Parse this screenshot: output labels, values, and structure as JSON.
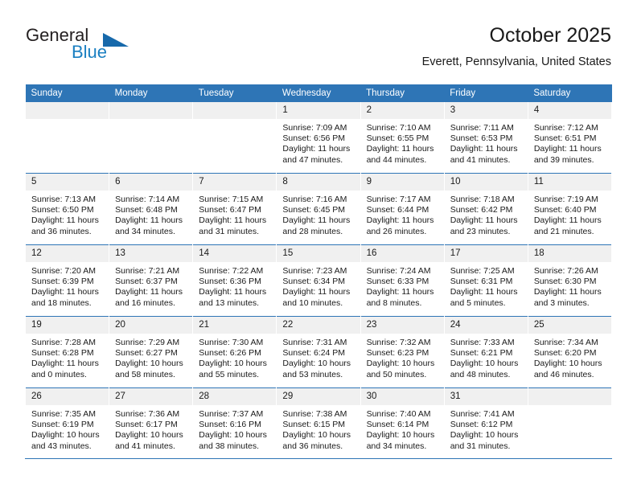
{
  "brand": {
    "name_part1": "General",
    "name_part2": "Blue",
    "logo_icon": "triangle-icon"
  },
  "header": {
    "title": "October 2025",
    "location": "Everett, Pennsylvania, United States"
  },
  "colors": {
    "header_bar": "#2e75b6",
    "day_band": "#f0f0f0",
    "brand_blue": "#1a7fc1",
    "text": "#1a1a1a"
  },
  "weekday_headers": [
    "Sunday",
    "Monday",
    "Tuesday",
    "Wednesday",
    "Thursday",
    "Friday",
    "Saturday"
  ],
  "weeks": [
    [
      {
        "day": "",
        "empty": true,
        "sunrise": "",
        "sunset": "",
        "daylight1": "",
        "daylight2": ""
      },
      {
        "day": "",
        "empty": true,
        "sunrise": "",
        "sunset": "",
        "daylight1": "",
        "daylight2": ""
      },
      {
        "day": "",
        "empty": true,
        "sunrise": "",
        "sunset": "",
        "daylight1": "",
        "daylight2": ""
      },
      {
        "day": "1",
        "sunrise": "Sunrise: 7:09 AM",
        "sunset": "Sunset: 6:56 PM",
        "daylight1": "Daylight: 11 hours",
        "daylight2": "and 47 minutes."
      },
      {
        "day": "2",
        "sunrise": "Sunrise: 7:10 AM",
        "sunset": "Sunset: 6:55 PM",
        "daylight1": "Daylight: 11 hours",
        "daylight2": "and 44 minutes."
      },
      {
        "day": "3",
        "sunrise": "Sunrise: 7:11 AM",
        "sunset": "Sunset: 6:53 PM",
        "daylight1": "Daylight: 11 hours",
        "daylight2": "and 41 minutes."
      },
      {
        "day": "4",
        "sunrise": "Sunrise: 7:12 AM",
        "sunset": "Sunset: 6:51 PM",
        "daylight1": "Daylight: 11 hours",
        "daylight2": "and 39 minutes."
      }
    ],
    [
      {
        "day": "5",
        "sunrise": "Sunrise: 7:13 AM",
        "sunset": "Sunset: 6:50 PM",
        "daylight1": "Daylight: 11 hours",
        "daylight2": "and 36 minutes."
      },
      {
        "day": "6",
        "sunrise": "Sunrise: 7:14 AM",
        "sunset": "Sunset: 6:48 PM",
        "daylight1": "Daylight: 11 hours",
        "daylight2": "and 34 minutes."
      },
      {
        "day": "7",
        "sunrise": "Sunrise: 7:15 AM",
        "sunset": "Sunset: 6:47 PM",
        "daylight1": "Daylight: 11 hours",
        "daylight2": "and 31 minutes."
      },
      {
        "day": "8",
        "sunrise": "Sunrise: 7:16 AM",
        "sunset": "Sunset: 6:45 PM",
        "daylight1": "Daylight: 11 hours",
        "daylight2": "and 28 minutes."
      },
      {
        "day": "9",
        "sunrise": "Sunrise: 7:17 AM",
        "sunset": "Sunset: 6:44 PM",
        "daylight1": "Daylight: 11 hours",
        "daylight2": "and 26 minutes."
      },
      {
        "day": "10",
        "sunrise": "Sunrise: 7:18 AM",
        "sunset": "Sunset: 6:42 PM",
        "daylight1": "Daylight: 11 hours",
        "daylight2": "and 23 minutes."
      },
      {
        "day": "11",
        "sunrise": "Sunrise: 7:19 AM",
        "sunset": "Sunset: 6:40 PM",
        "daylight1": "Daylight: 11 hours",
        "daylight2": "and 21 minutes."
      }
    ],
    [
      {
        "day": "12",
        "sunrise": "Sunrise: 7:20 AM",
        "sunset": "Sunset: 6:39 PM",
        "daylight1": "Daylight: 11 hours",
        "daylight2": "and 18 minutes."
      },
      {
        "day": "13",
        "sunrise": "Sunrise: 7:21 AM",
        "sunset": "Sunset: 6:37 PM",
        "daylight1": "Daylight: 11 hours",
        "daylight2": "and 16 minutes."
      },
      {
        "day": "14",
        "sunrise": "Sunrise: 7:22 AM",
        "sunset": "Sunset: 6:36 PM",
        "daylight1": "Daylight: 11 hours",
        "daylight2": "and 13 minutes."
      },
      {
        "day": "15",
        "sunrise": "Sunrise: 7:23 AM",
        "sunset": "Sunset: 6:34 PM",
        "daylight1": "Daylight: 11 hours",
        "daylight2": "and 10 minutes."
      },
      {
        "day": "16",
        "sunrise": "Sunrise: 7:24 AM",
        "sunset": "Sunset: 6:33 PM",
        "daylight1": "Daylight: 11 hours",
        "daylight2": "and 8 minutes."
      },
      {
        "day": "17",
        "sunrise": "Sunrise: 7:25 AM",
        "sunset": "Sunset: 6:31 PM",
        "daylight1": "Daylight: 11 hours",
        "daylight2": "and 5 minutes."
      },
      {
        "day": "18",
        "sunrise": "Sunrise: 7:26 AM",
        "sunset": "Sunset: 6:30 PM",
        "daylight1": "Daylight: 11 hours",
        "daylight2": "and 3 minutes."
      }
    ],
    [
      {
        "day": "19",
        "sunrise": "Sunrise: 7:28 AM",
        "sunset": "Sunset: 6:28 PM",
        "daylight1": "Daylight: 11 hours",
        "daylight2": "and 0 minutes."
      },
      {
        "day": "20",
        "sunrise": "Sunrise: 7:29 AM",
        "sunset": "Sunset: 6:27 PM",
        "daylight1": "Daylight: 10 hours",
        "daylight2": "and 58 minutes."
      },
      {
        "day": "21",
        "sunrise": "Sunrise: 7:30 AM",
        "sunset": "Sunset: 6:26 PM",
        "daylight1": "Daylight: 10 hours",
        "daylight2": "and 55 minutes."
      },
      {
        "day": "22",
        "sunrise": "Sunrise: 7:31 AM",
        "sunset": "Sunset: 6:24 PM",
        "daylight1": "Daylight: 10 hours",
        "daylight2": "and 53 minutes."
      },
      {
        "day": "23",
        "sunrise": "Sunrise: 7:32 AM",
        "sunset": "Sunset: 6:23 PM",
        "daylight1": "Daylight: 10 hours",
        "daylight2": "and 50 minutes."
      },
      {
        "day": "24",
        "sunrise": "Sunrise: 7:33 AM",
        "sunset": "Sunset: 6:21 PM",
        "daylight1": "Daylight: 10 hours",
        "daylight2": "and 48 minutes."
      },
      {
        "day": "25",
        "sunrise": "Sunrise: 7:34 AM",
        "sunset": "Sunset: 6:20 PM",
        "daylight1": "Daylight: 10 hours",
        "daylight2": "and 46 minutes."
      }
    ],
    [
      {
        "day": "26",
        "sunrise": "Sunrise: 7:35 AM",
        "sunset": "Sunset: 6:19 PM",
        "daylight1": "Daylight: 10 hours",
        "daylight2": "and 43 minutes."
      },
      {
        "day": "27",
        "sunrise": "Sunrise: 7:36 AM",
        "sunset": "Sunset: 6:17 PM",
        "daylight1": "Daylight: 10 hours",
        "daylight2": "and 41 minutes."
      },
      {
        "day": "28",
        "sunrise": "Sunrise: 7:37 AM",
        "sunset": "Sunset: 6:16 PM",
        "daylight1": "Daylight: 10 hours",
        "daylight2": "and 38 minutes."
      },
      {
        "day": "29",
        "sunrise": "Sunrise: 7:38 AM",
        "sunset": "Sunset: 6:15 PM",
        "daylight1": "Daylight: 10 hours",
        "daylight2": "and 36 minutes."
      },
      {
        "day": "30",
        "sunrise": "Sunrise: 7:40 AM",
        "sunset": "Sunset: 6:14 PM",
        "daylight1": "Daylight: 10 hours",
        "daylight2": "and 34 minutes."
      },
      {
        "day": "31",
        "sunrise": "Sunrise: 7:41 AM",
        "sunset": "Sunset: 6:12 PM",
        "daylight1": "Daylight: 10 hours",
        "daylight2": "and 31 minutes."
      },
      {
        "day": "",
        "empty": true,
        "sunrise": "",
        "sunset": "",
        "daylight1": "",
        "daylight2": ""
      }
    ]
  ]
}
